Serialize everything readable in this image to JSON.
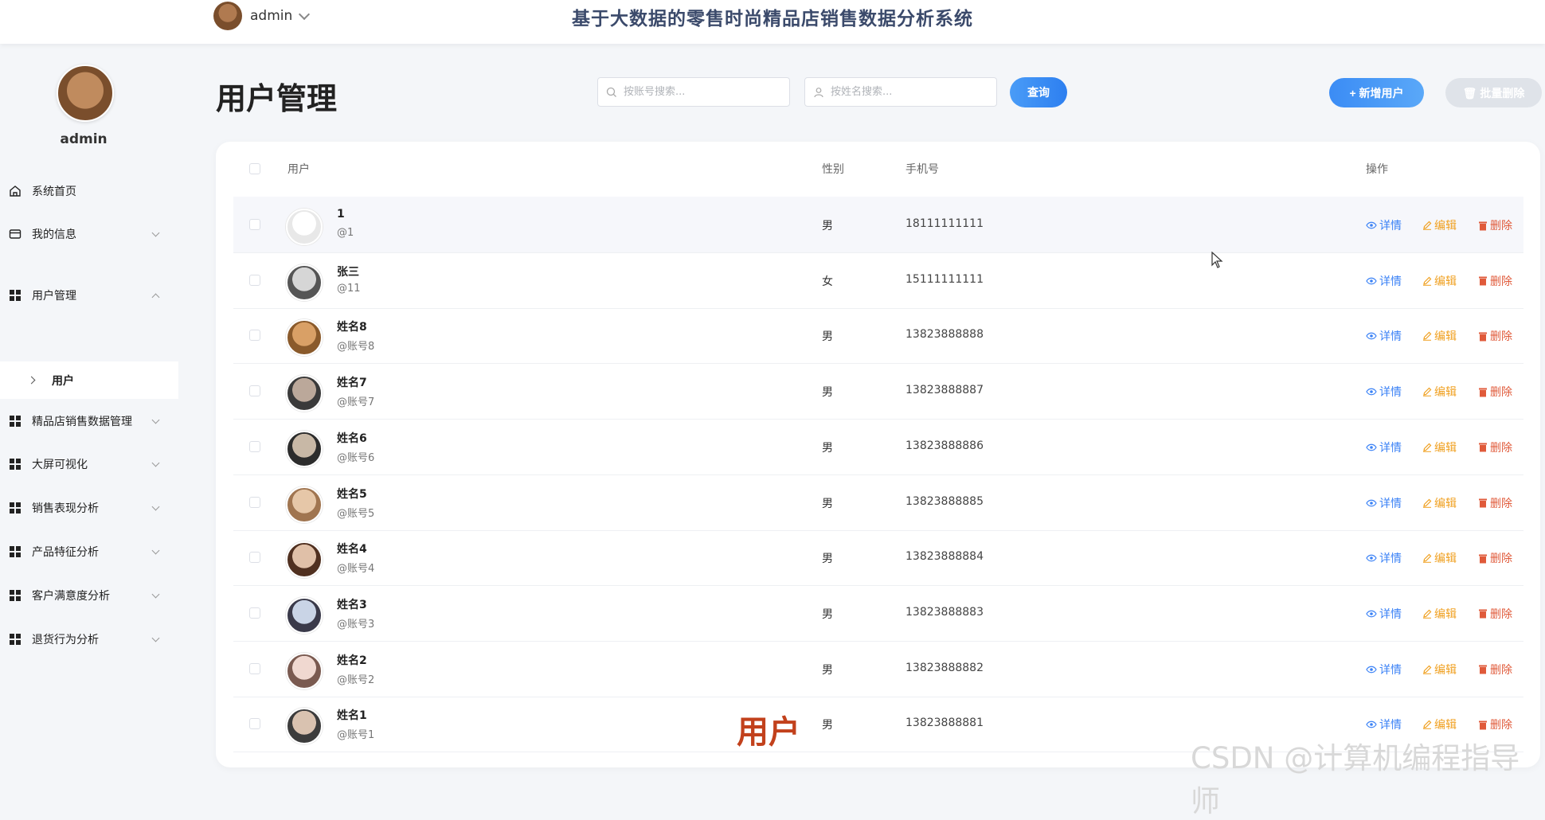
{
  "header": {
    "username": "admin",
    "system_title": "基于大数据的零售时尚精品店销售数据分析系统"
  },
  "sidebar": {
    "username": "admin",
    "items": [
      {
        "label": "系统首页",
        "icon": "home-icon"
      },
      {
        "label": "我的信息",
        "icon": "card-icon"
      },
      {
        "label": "用户管理",
        "icon": "grid-icon"
      },
      {
        "label": "精品店销售数据管理",
        "icon": "grid-icon"
      },
      {
        "label": "大屏可视化",
        "icon": "grid-icon"
      },
      {
        "label": "销售表现分析",
        "icon": "grid-icon"
      },
      {
        "label": "产品特征分析",
        "icon": "grid-icon"
      },
      {
        "label": "客户满意度分析",
        "icon": "grid-icon"
      },
      {
        "label": "退货行为分析",
        "icon": "grid-icon"
      }
    ],
    "subitem": "用户"
  },
  "page": {
    "title": "用户管理",
    "search_account_placeholder": "按账号搜索...",
    "search_name_placeholder": "按姓名搜索...",
    "query_label": "查询",
    "add_label": "+ 新增用户",
    "batch_delete_label": "批量删除"
  },
  "table": {
    "headers": {
      "user": "用户",
      "gender": "性别",
      "phone": "手机号",
      "op": "操作"
    },
    "actions": {
      "detail": "详情",
      "edit": "编辑",
      "delete": "删除"
    },
    "rows": [
      {
        "name": "1",
        "account": "@1",
        "gender": "男",
        "phone": "18111111111"
      },
      {
        "name": "张三",
        "account": "@11",
        "gender": "女",
        "phone": "15111111111"
      },
      {
        "name": "姓名8",
        "account": "@账号8",
        "gender": "男",
        "phone": "13823888888"
      },
      {
        "name": "姓名7",
        "account": "@账号7",
        "gender": "男",
        "phone": "13823888887"
      },
      {
        "name": "姓名6",
        "account": "@账号6",
        "gender": "男",
        "phone": "13823888886"
      },
      {
        "name": "姓名5",
        "account": "@账号5",
        "gender": "男",
        "phone": "13823888885"
      },
      {
        "name": "姓名4",
        "account": "@账号4",
        "gender": "男",
        "phone": "13823888884"
      },
      {
        "name": "姓名3",
        "account": "@账号3",
        "gender": "男",
        "phone": "13823888883"
      },
      {
        "name": "姓名2",
        "account": "@账号2",
        "gender": "男",
        "phone": "13823888882"
      },
      {
        "name": "姓名1",
        "account": "@账号1",
        "gender": "男",
        "phone": "13823888881"
      }
    ]
  },
  "overlay": {
    "label": "用户",
    "csdn": "CSDN @计算机编程指导师"
  }
}
